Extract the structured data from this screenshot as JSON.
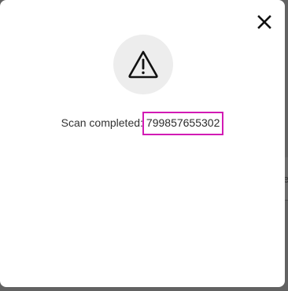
{
  "dialog": {
    "message_label": "Scan completed:",
    "scan_code": "799857655302",
    "icon": "warning-triangle-icon",
    "close_icon": "close-icon"
  },
  "backdrop": {
    "edge_text": "e"
  },
  "colors": {
    "overlay": "#626262",
    "dialog_bg": "#ffffff",
    "icon_bg": "#ededed",
    "highlight_border": "#d21bb4",
    "text": "#2b2b2b"
  }
}
